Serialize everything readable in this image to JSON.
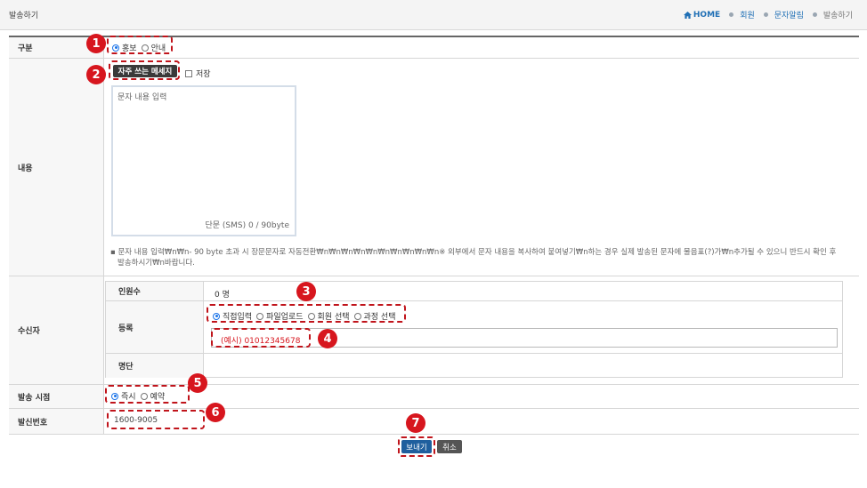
{
  "header": {
    "title": "발송하기",
    "breadcrumb": {
      "home": "HOME",
      "items": [
        "회원",
        "문자알림"
      ],
      "current": "발송하기"
    }
  },
  "form": {
    "category": {
      "label": "구분",
      "options": [
        "홍보",
        "안내"
      ],
      "selected": "홍보"
    },
    "content": {
      "label": "내용",
      "frequent_button": "자주 쓰는 메세지",
      "save_label": "저장",
      "placeholder": "문자 내용 입력",
      "counter": "단문 (SMS) 0 / 90byte",
      "note_line1": "문자 내용 입력₩n₩n- 90 byte 초과 시 장문문자로 자동전환₩n₩n₩n₩n₩n₩n₩n₩n₩n₩n※ 외부에서 문자 내용을 복사하여 붙여넣기₩n하는 경우 실제 발송된 문자에 물음표(?)가₩n추가될 수 있으니 반드시 확인 후",
      "note_line2": "발송하시기₩n바랍니다."
    },
    "recipients": {
      "label": "수신자",
      "count_label": "인원수",
      "count_value": "0 명",
      "register_label": "등록",
      "register_options": [
        "직접입력",
        "파일업로드",
        "회원 선택",
        "과정 선택"
      ],
      "register_selected": "직접입력",
      "phone_placeholder": "(예시) 01012345678",
      "list_label": "명단"
    },
    "send_time": {
      "label": "발송 시점",
      "options": [
        "즉시",
        "예약"
      ],
      "selected": "즉시"
    },
    "sender": {
      "label": "발신번호",
      "value": "1600-9005"
    }
  },
  "buttons": {
    "send": "보내기",
    "cancel": "취소"
  },
  "annotations": [
    "1",
    "2",
    "3",
    "4",
    "5",
    "6",
    "7"
  ],
  "colors": {
    "annotation_red": "#d7161e",
    "link_blue": "#1f6fb5",
    "send_button": "#1f5f9e"
  }
}
